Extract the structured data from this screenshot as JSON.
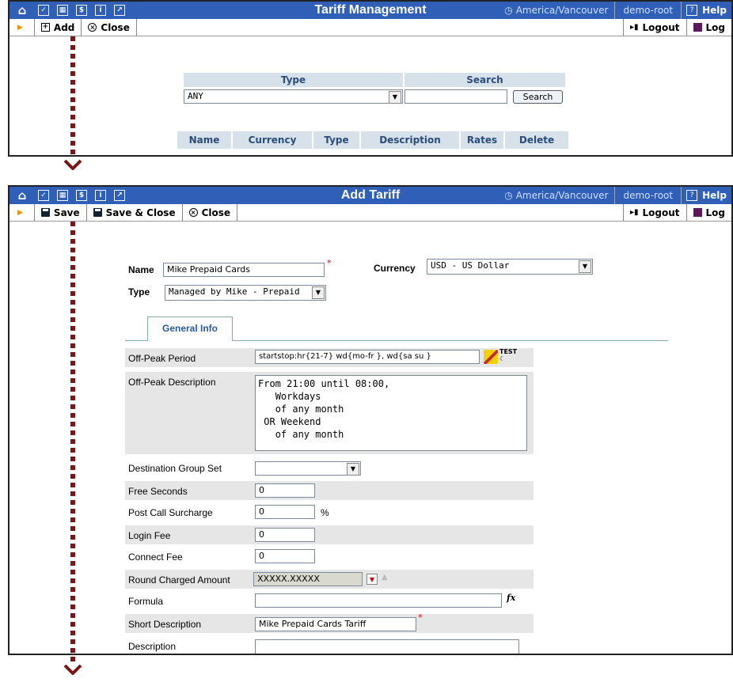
{
  "common": {
    "timezone": "America/Vancouver",
    "user": "demo-root",
    "help": "Help",
    "logout": "Logout",
    "log": "Log",
    "nav_icons": [
      "home-icon",
      "checkbox-icon",
      "grid-icon",
      "dollar-icon",
      "info-icon",
      "chart-icon"
    ]
  },
  "panel1": {
    "title": "Tariff Management",
    "toolbar": {
      "add": "Add",
      "close": "Close"
    },
    "filter": {
      "type_header": "Type",
      "search_header": "Search",
      "type_value": "ANY",
      "search_value": "",
      "search_button": "Search"
    },
    "columns": [
      "Name",
      "Currency",
      "Type",
      "Description",
      "Rates",
      "Delete"
    ]
  },
  "panel2": {
    "title": "Add Tariff",
    "toolbar": {
      "save": "Save",
      "save_close": "Save & Close",
      "close": "Close"
    },
    "name_label": "Name",
    "name_value": "Mike Prepaid Cards",
    "currency_label": "Currency",
    "currency_value": "USD - US Dollar",
    "type_label": "Type",
    "type_value": "Managed by Mike - Prepaid",
    "tab_general": "General Info",
    "fields": {
      "offpeak_period_label": "Off-Peak Period",
      "offpeak_period_value": "startstop:hr{21-7} wd{mo-fr }, wd{sa su }",
      "offpeak_desc_label": "Off-Peak Description",
      "offpeak_desc_value": "From 21:00 until 08:00,\n   Workdays\n   of any month\n OR Weekend\n   of any month",
      "dest_group_label": "Destination Group Set",
      "dest_group_value": "",
      "free_seconds_label": "Free Seconds",
      "free_seconds_value": "0",
      "post_call_label": "Post Call Surcharge",
      "post_call_value": "0",
      "post_call_unit": "%",
      "login_fee_label": "Login Fee",
      "login_fee_value": "0",
      "connect_fee_label": "Connect Fee",
      "connect_fee_value": "0",
      "round_label": "Round Charged Amount",
      "round_value": "XXXXX.XXXXX",
      "formula_label": "Formula",
      "formula_value": "",
      "short_desc_label": "Short Description",
      "short_desc_value": "Mike Prepaid Cards Tariff",
      "desc_label": "Description",
      "desc_value": ""
    }
  }
}
